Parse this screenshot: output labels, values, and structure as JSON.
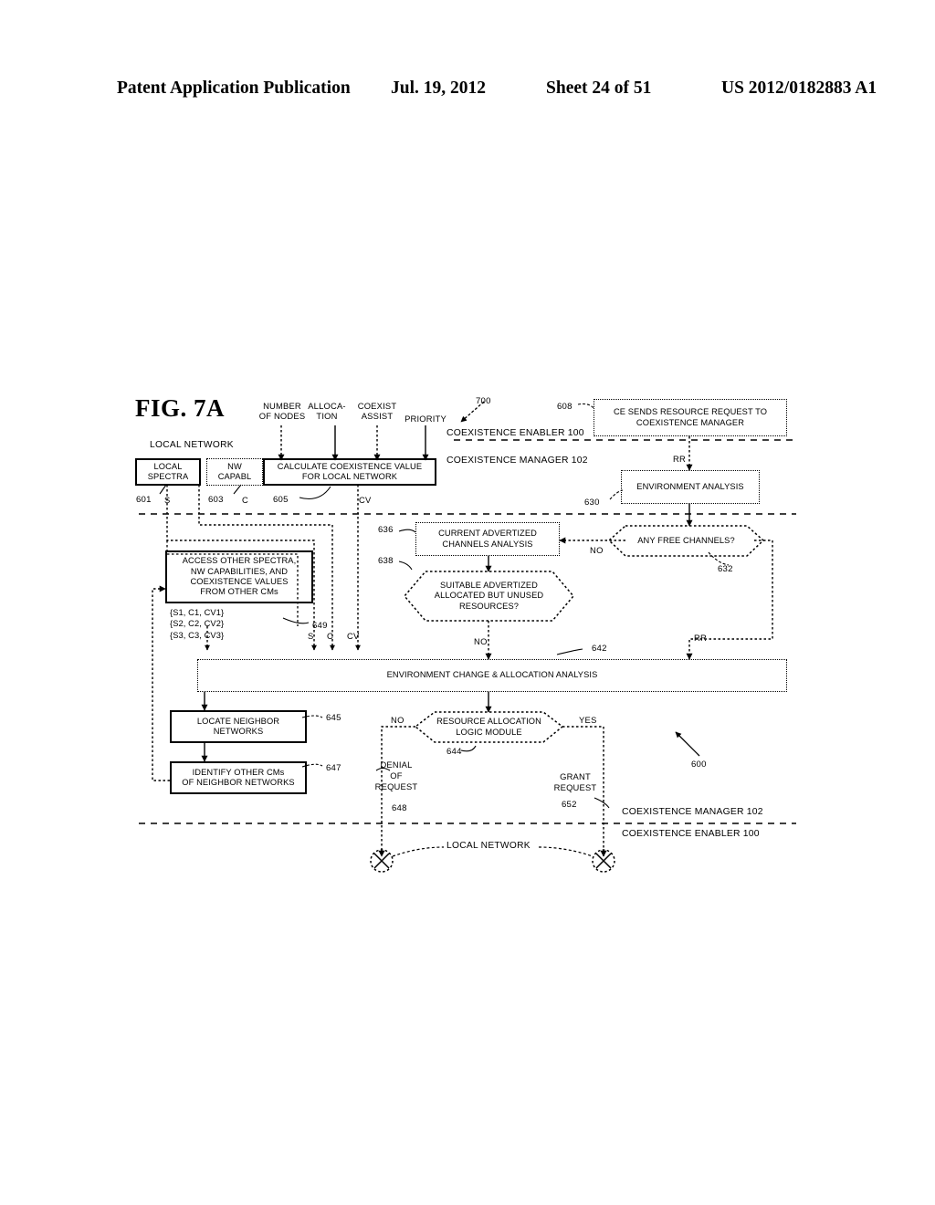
{
  "page_header": {
    "publication": "Patent Application Publication",
    "date": "Jul. 19, 2012",
    "sheet": "Sheet 24 of 51",
    "patent_number": "US 2012/0182883 A1"
  },
  "figure": {
    "number": "FIG. 7A",
    "diagram_ref": "700",
    "system_ref": "600",
    "local_network_label_top": "LOCAL NETWORK",
    "local_network_label_bottom": "LOCAL NETWORK",
    "boundaries": {
      "top_enabler": "COEXISTENCE ENABLER 100",
      "top_enabler_num": "100",
      "top_manager": "COEXISTENCE MANAGER 102",
      "top_manager_num": "102",
      "bottom_manager": "COEXISTENCE MANAGER 102",
      "bottom_manager_num": "102",
      "bottom_enabler": "COEXISTENCE ENABLER 100",
      "bottom_enabler_num": "100"
    },
    "inputs": [
      {
        "name": "number-of-nodes",
        "line1": "NUMBER",
        "line2": "OF NODES"
      },
      {
        "name": "allocation",
        "line1": "ALLOCA-",
        "line2": "TION"
      },
      {
        "name": "coexist-assist",
        "line1": "COEXIST",
        "line2": "ASSIST"
      },
      {
        "name": "priority",
        "line1": "PRIORITY",
        "line2": ""
      }
    ],
    "nodes": [
      {
        "id": "601",
        "name": "local-spectra",
        "text": "LOCAL\nSPECTRA",
        "ref": "601",
        "style": "solid"
      },
      {
        "id": "603",
        "name": "nw-capabl",
        "text": "NW\nCAPABL",
        "ref": "603",
        "style": "dotted"
      },
      {
        "id": "605",
        "name": "calculate-coexistence-value",
        "text": "CALCULATE COEXISTENCE VALUE\nFOR LOCAL NETWORK",
        "ref": "605",
        "style": "solid"
      },
      {
        "id": "608",
        "name": "ce-sends-resource-request",
        "text": "CE SENDS RESOURCE REQUEST TO\nCOEXISTENCE MANAGER",
        "ref": "608",
        "style": "dotted"
      },
      {
        "id": "630",
        "name": "environment-analysis",
        "text": "ENVIRONMENT ANALYSIS",
        "ref": "630",
        "style": "dotted"
      },
      {
        "id": "632",
        "name": "any-free-channels",
        "text": "ANY FREE CHANNELS?",
        "ref": "632",
        "style": "hex"
      },
      {
        "id": "636",
        "name": "current-advertized-channels-analysis",
        "text": "CURRENT ADVERTIZED\nCHANNELS ANALYSIS",
        "ref": "636",
        "style": "dotted"
      },
      {
        "id": "638",
        "name": "suitable-advertized-resources",
        "text": "SUITABLE ADVERTIZED\nALLOCATED BUT UNUSED\nRESOURCES?",
        "ref": "638",
        "style": "hex"
      },
      {
        "id": "649",
        "name": "access-other-spectra",
        "text": "ACCESS OTHER SPECTRA,\nNW CAPABILITIES, AND\nCOEXISTENCE VALUES\nFROM OTHER CMs",
        "ref": "649",
        "style": "solid"
      },
      {
        "id": "642",
        "name": "environment-change-allocation-analysis",
        "text": "ENVIRONMENT CHANGE & ALLOCATION ANALYSIS",
        "ref": "642",
        "style": "dotted"
      },
      {
        "id": "645",
        "name": "locate-neighbor-networks",
        "text": "LOCATE NEIGHBOR\nNETWORKS",
        "ref": "645",
        "style": "solid"
      },
      {
        "id": "647",
        "name": "identify-other-cms",
        "text": "IDENTIFY OTHER CMs\nOF NEIGHBOR NETWORKS",
        "ref": "647",
        "style": "solid"
      },
      {
        "id": "644",
        "name": "resource-allocation-logic-module",
        "text": "RESOURCE ALLOCATION\nLOGIC MODULE",
        "ref": "644",
        "style": "hex"
      }
    ],
    "set_values": "{S1, C1, CV1}\n{S2, C2, CV2}\n{S3, C3, CV3}",
    "signal_labels": {
      "s": "S",
      "c": "C",
      "cv": "CV",
      "rr": "RR"
    },
    "branch_labels": {
      "no_free_channels": "NO",
      "no_suitable": "NO",
      "no_alloc": "NO",
      "yes_alloc": "YES"
    },
    "outcomes": [
      {
        "name": "denial-of-request",
        "text": "DENIAL\nOF\nREQUEST",
        "ref": "648"
      },
      {
        "name": "grant-request",
        "text": "GRANT\nREQUEST",
        "ref": "652"
      }
    ]
  }
}
